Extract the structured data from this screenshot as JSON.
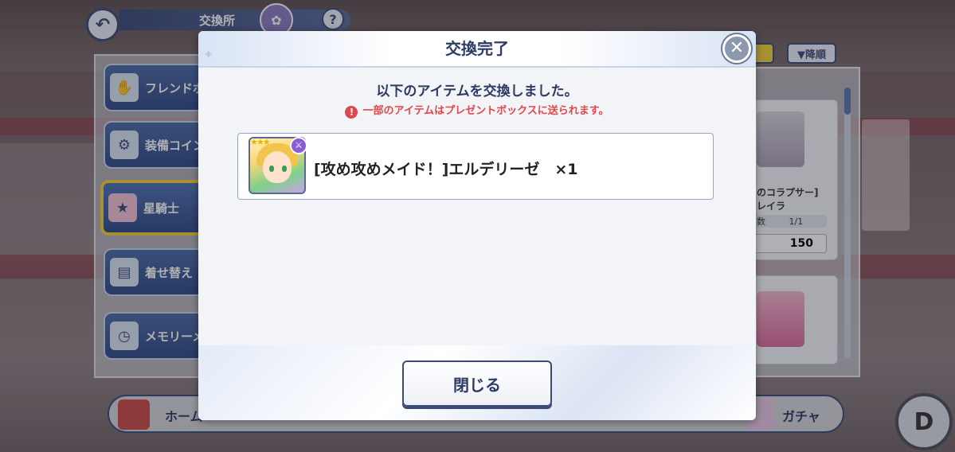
{
  "header": {
    "title": "交換所",
    "help_label": "?",
    "back_icon": "back-arrow-icon"
  },
  "categories": [
    {
      "label": "フレンドポイ",
      "icon": "handshake-icon",
      "selected": false
    },
    {
      "label": "装備コイン",
      "icon": "gear-coin-icon",
      "selected": false
    },
    {
      "label": "星騎士",
      "icon": "character-icon",
      "selected": true
    },
    {
      "label": "着せ替え",
      "icon": "costume-ticket-icon",
      "selected": false
    },
    {
      "label": "メモリーメダ",
      "icon": "memory-clock-icon",
      "selected": false
    }
  ],
  "list_panel": {
    "sort_label": "▼降順",
    "card1": {
      "name_line1": "のコラプサー]",
      "name_line2": "レイラ",
      "stock_label": "数",
      "stock_value": "1/1",
      "price": "150"
    }
  },
  "bottom_nav": {
    "home_label": "ホーム",
    "gacha_label": "ガチャ",
    "d_label": "D"
  },
  "modal": {
    "title": "交換完了",
    "message": "以下のアイテムを交換しました。",
    "warning": "一部のアイテムはプレゼントボックスに送られます。",
    "warning_icon": "!",
    "close_icon": "✕",
    "item": {
      "name": "[攻め攻めメイド！]エルデリーゼ　×1",
      "rarity_stars": "★★★",
      "attribute_badge": "ATK"
    },
    "close_button_label": "閉じる"
  },
  "colors": {
    "navy": "#3b4a7a",
    "warning_red": "#e0474c",
    "selected_gold": "#f2cf3a"
  }
}
